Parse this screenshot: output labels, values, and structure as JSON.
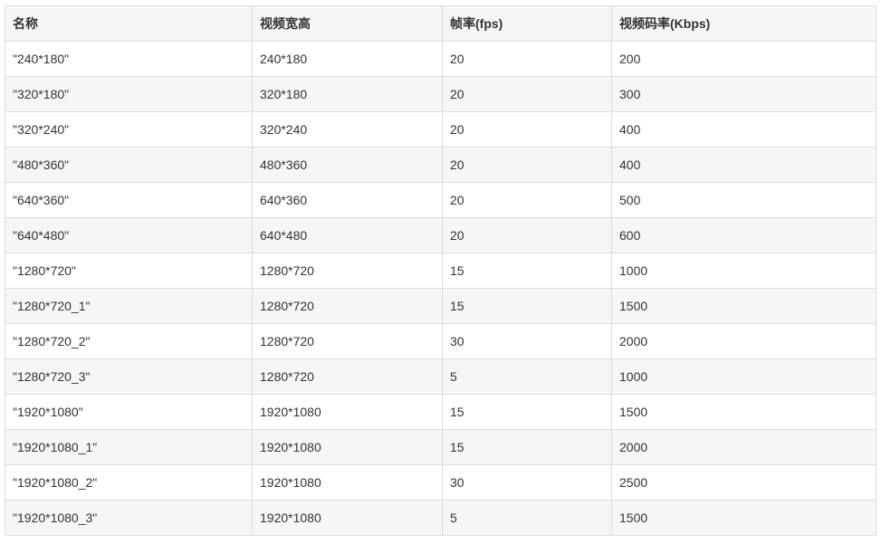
{
  "table": {
    "headers": [
      "名称",
      "视频宽高",
      "帧率(fps)",
      "视频码率(Kbps)"
    ],
    "rows": [
      [
        "\"240*180\"",
        "240*180",
        "20",
        "200"
      ],
      [
        "\"320*180\"",
        "320*180",
        "20",
        "300"
      ],
      [
        "\"320*240\"",
        "320*240",
        "20",
        "400"
      ],
      [
        "\"480*360\"",
        "480*360",
        "20",
        "400"
      ],
      [
        "\"640*360\"",
        "640*360",
        "20",
        "500"
      ],
      [
        "\"640*480\"",
        "640*480",
        "20",
        "600"
      ],
      [
        "\"1280*720\"",
        "1280*720",
        "15",
        "1000"
      ],
      [
        "\"1280*720_1\"",
        "1280*720",
        "15",
        "1500"
      ],
      [
        "\"1280*720_2\"",
        "1280*720",
        "30",
        "2000"
      ],
      [
        "\"1280*720_3\"",
        "1280*720",
        "5",
        "1000"
      ],
      [
        "\"1920*1080\"",
        "1920*1080",
        "15",
        "1500"
      ],
      [
        "\"1920*1080_1\"",
        "1920*1080",
        "15",
        "2000"
      ],
      [
        "\"1920*1080_2\"",
        "1920*1080",
        "30",
        "2500"
      ],
      [
        "\"1920*1080_3\"",
        "1920*1080",
        "5",
        "1500"
      ]
    ]
  }
}
